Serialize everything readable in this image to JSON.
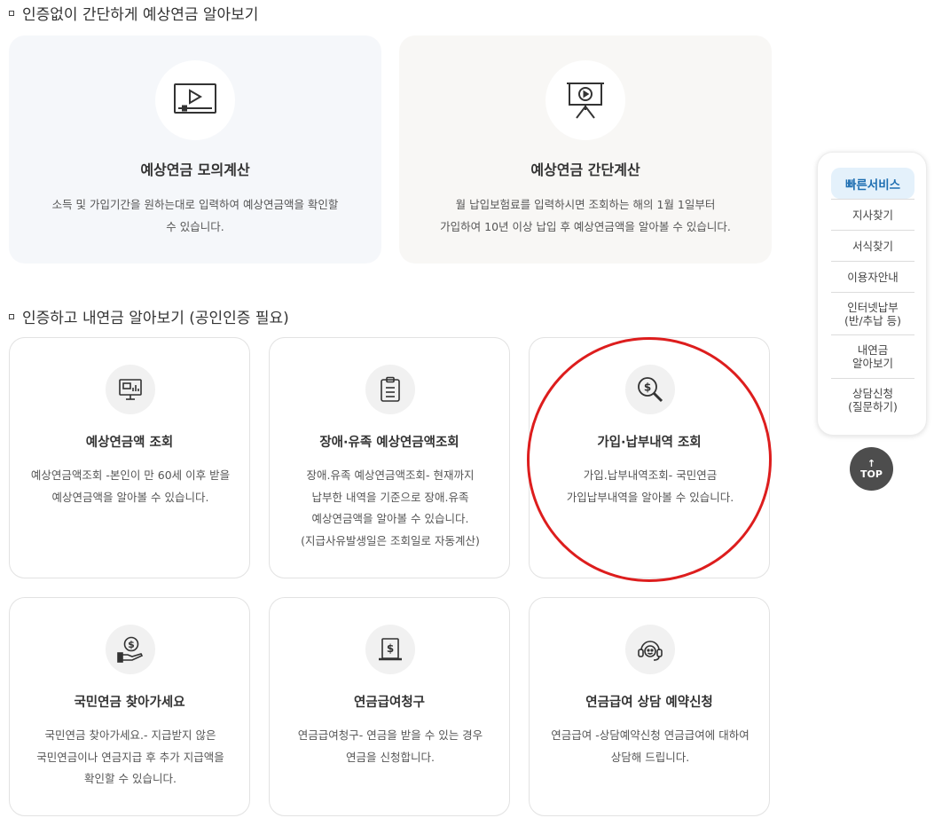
{
  "section1": {
    "title": "인증없이 간단하게 예상연금 알아보기",
    "cards": [
      {
        "icon": "video-player-icon",
        "title": "예상연금 모의계산",
        "desc": [
          "소득 및 가입기간을 원하는대로 입력하여 예상연금액을 확인할",
          "수 있습니다."
        ]
      },
      {
        "icon": "presentation-board-icon",
        "title": "예상연금 간단계산",
        "desc": [
          "월 납입보험료를 입력하시면 조회하는 해의 1월 1일부터",
          "가입하여 10년 이상 납입 후 예상연금액을 알아볼 수 있습니다."
        ]
      }
    ]
  },
  "section2": {
    "title": "인증하고 내연금 알아보기 (공인인증 필요)",
    "cards": [
      {
        "icon": "monitor-chart-icon",
        "title": "예상연금액 조회",
        "desc": [
          "예상연금액조회 -본인이 만 60세 이후 받을",
          "예상연금액을 알아볼 수 있습니다."
        ]
      },
      {
        "icon": "clipboard-icon",
        "title": "장애·유족 예상연금액조회",
        "desc": [
          "장애.유족 예상연금액조회- 현재까지",
          "납부한 내역을 기준으로 장애.유족",
          "예상연금액을 알아볼 수 있습니다.",
          "(지급사유발생일은 조회일로 자동계산)"
        ]
      },
      {
        "icon": "dollar-search-icon",
        "title": "가입·납부내역 조회",
        "desc": [
          "가입.납부내역조회- 국민연금",
          "가입납부내역을 알아볼 수 있습니다."
        ]
      },
      {
        "icon": "hand-coin-icon",
        "title": "국민연금 찾아가세요",
        "desc": [
          "국민연금 찾아가세요.- 지급받지 않은",
          "국민연금이나 연금지급 후 추가 지급액을",
          "확인할 수 있습니다."
        ]
      },
      {
        "icon": "dollar-document-icon",
        "title": "연금급여청구",
        "desc": [
          "연금급여청구- 연금을 받을 수 있는 경우",
          "연금을 신청합니다."
        ]
      },
      {
        "icon": "headset-icon",
        "title": "연금급여 상담 예약신청",
        "desc": [
          "연금급여 -상담예약신청 연금급여에 대하여",
          "상담해 드립니다."
        ]
      }
    ]
  },
  "quick_menu": {
    "title": "빠른서비스",
    "items": [
      "지사찾기",
      "서식찾기",
      "이용자안내",
      "인터넷납부\n(반/추납 등)",
      "내연금\n알아보기",
      "상담신청\n(질문하기)"
    ]
  },
  "top_button": {
    "arrow": "↑",
    "label": "TOP"
  },
  "annotation": {
    "color": "#dd1d1d"
  }
}
